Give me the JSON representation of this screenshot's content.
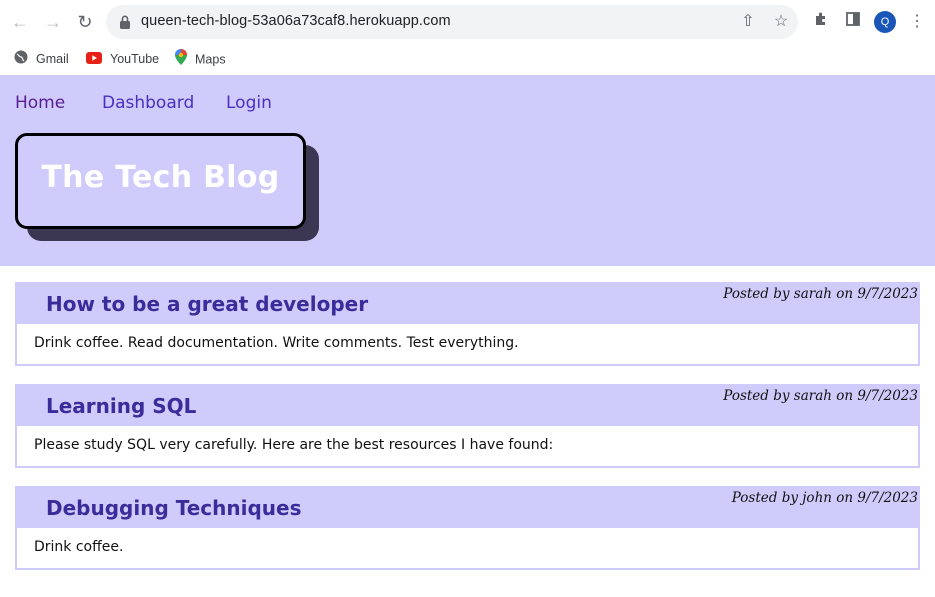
{
  "browser": {
    "url": "queen-tech-blog-53a06a73caf8.herokuapp.com",
    "profile_initial": "Q",
    "bookmarks": [
      {
        "label": "Gmail",
        "icon": "globe-icon"
      },
      {
        "label": "YouTube",
        "icon": "youtube-icon"
      },
      {
        "label": "Maps",
        "icon": "maps-icon"
      }
    ]
  },
  "nav": {
    "links": [
      {
        "label": "Home"
      },
      {
        "label": "Dashboard"
      },
      {
        "label": "Login"
      }
    ]
  },
  "site": {
    "title": "The Tech Blog"
  },
  "posts": [
    {
      "title": "How to be a great developer",
      "meta": "Posted by sarah on 9/7/2023",
      "body": "Drink coffee. Read documentation. Write comments. Test everything."
    },
    {
      "title": "Learning SQL",
      "meta": "Posted by sarah on 9/7/2023",
      "body": "Please study SQL very carefully. Here are the best resources I have found:"
    },
    {
      "title": "Debugging Techniques",
      "meta": "Posted by john on 9/7/2023",
      "body": "Drink coffee."
    }
  ],
  "colors": {
    "header_bg": "#cfcbfb",
    "title_text": "#ffffff",
    "post_title": "#3a2c99",
    "nav_link": "#4a2fc0",
    "nav_home": "#5a1d96"
  }
}
